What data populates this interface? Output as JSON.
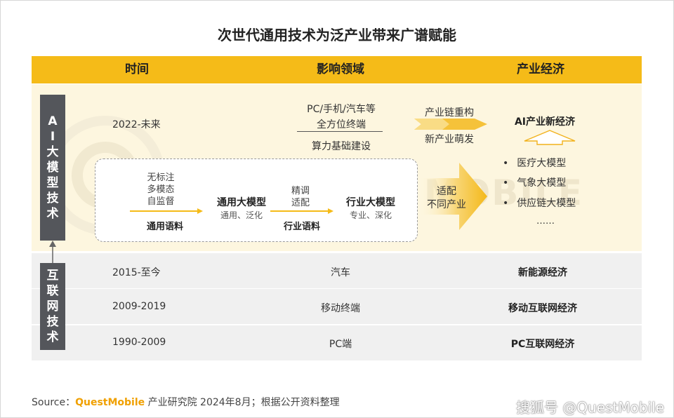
{
  "title": "次世代通用技术为泛产业带来广谱赋能",
  "columns": [
    "时间",
    "影响领域",
    "产业经济"
  ],
  "ai_tech": {
    "label": "AI大模型技术",
    "time": "2022-未来",
    "field_line1": "PC/手机/汽车等",
    "field_line2": "全方位终端",
    "field_line3": "算力基础建设",
    "chain_top": "产业链重构",
    "chain_bottom": "新产业萌发",
    "adapt_line1": "适配",
    "adapt_line2": "不同产业",
    "economy_title": "AI产业新经济",
    "economy_items": [
      "医疗大模型",
      "气象大模型",
      "供应链大模型",
      "……"
    ],
    "flow": {
      "input_labels": [
        "无标注",
        "多模态",
        "自监督"
      ],
      "input_caption": "通用语料",
      "general_model": "通用大模型",
      "general_sub": "通用、泛化",
      "mid_labels": [
        "精调",
        "适配"
      ],
      "mid_caption": "行业语料",
      "industry_model": "行业大模型",
      "industry_sub": "专业、深化"
    }
  },
  "internet_tech": {
    "label": "互联网技术",
    "rows": [
      {
        "time": "2015-至今",
        "field": "汽车",
        "economy": "新能源经济"
      },
      {
        "time": "2009-2019",
        "field": "移动终端",
        "economy": "移动互联网经济"
      },
      {
        "time": "1990-2009",
        "field": "PC端",
        "economy": "PC互联网经济"
      }
    ]
  },
  "watermark_text": "MOBILE",
  "source": {
    "prefix": "Source：",
    "brand": "QuestMobile",
    "rest": " 产业研究院 2024年8月；根据公开资料整理"
  },
  "corner_watermark": "搜狐号 @QuestMobile",
  "colors": {
    "header": "#f5bb18",
    "ai_zone": "#fdf6df",
    "row": "#f0f0f0",
    "label_bar": "#54565b",
    "accent": "#f5bb18"
  }
}
